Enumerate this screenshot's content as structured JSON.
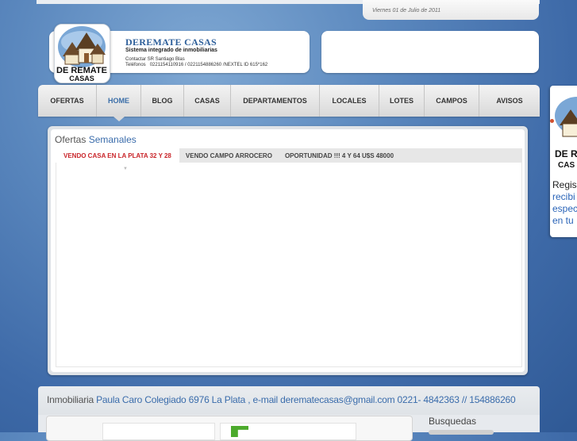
{
  "header": {
    "date": "Viernes 01 de Julio de 2011",
    "brand_title": "DEREMATE CASAS",
    "brand_subtitle": "Sistema integrado de inmobiliarias",
    "contact_line": "Contactar SR Santiago Blas",
    "phones_label": "Teléfonos",
    "phones_value": "0221154110916 / 0221154886260 /NEXTEL ID 615*162",
    "logo_top_text": "DE REMATE",
    "logo_bottom_text": "CASAS"
  },
  "nav": {
    "items": [
      {
        "label": "OFERTAS"
      },
      {
        "label": "HOME"
      },
      {
        "label": "BLOG"
      },
      {
        "label": "CASAS"
      },
      {
        "label": "DEPARTAMENTOS"
      },
      {
        "label": "LOCALES"
      },
      {
        "label": "LOTES"
      },
      {
        "label": "CAMPOS"
      },
      {
        "label": "AVISOS"
      }
    ],
    "active_index": 1
  },
  "offers": {
    "title_prefix": "Ofertas",
    "title_highlight": "Semanales",
    "tabs": [
      {
        "label": "VENDO CASA EN LA PLATA 32 Y 28"
      },
      {
        "label": "VENDO CAMPO ARROCERO"
      },
      {
        "label": "OPORTUNIDAD !!! 4 Y 64 U$S 48000"
      }
    ],
    "active_tab": 0
  },
  "footer": {
    "prefix": "Inmobiliaria",
    "info": "Paula Caro Colegiado 6976 La Plata , e-mail derematecasas@gmail.com 0221- 4842363 // 154886260",
    "search_label": "Busquedas"
  },
  "side_widget": {
    "lines": [
      "Regis",
      "recibi",
      "espec",
      "en tu"
    ],
    "logo_top_text": "DE R",
    "logo_bottom_text": "CAS"
  },
  "colors": {
    "accent": "#3a6cab",
    "active_tab": "#c9252a",
    "background": "#4a78b2"
  }
}
